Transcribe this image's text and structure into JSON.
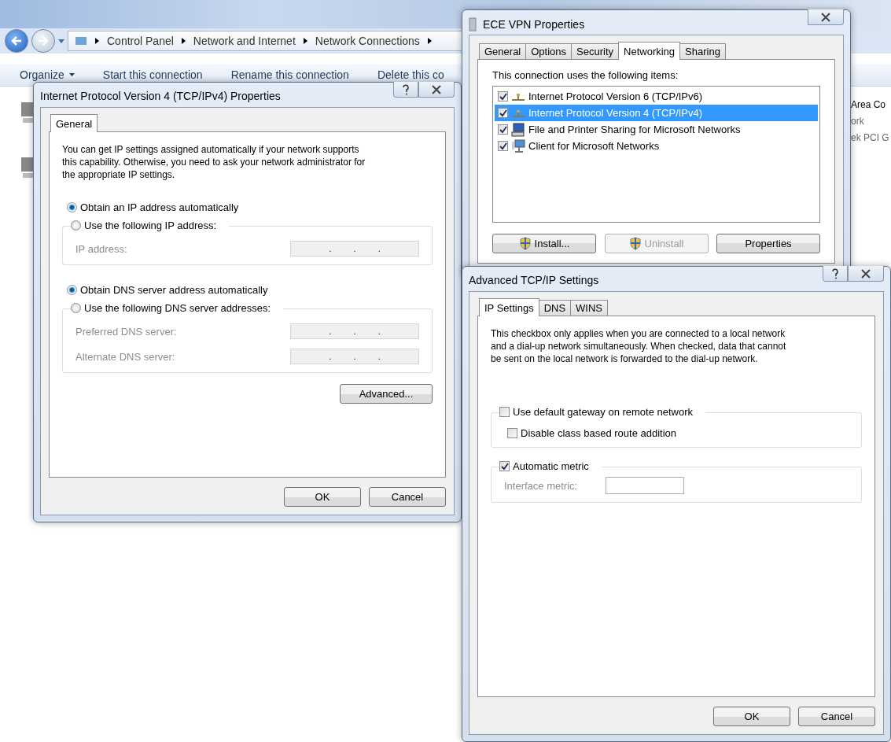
{
  "explorer": {
    "breadcrumb": [
      "Control Panel",
      "Network and Internet",
      "Network Connections"
    ],
    "toolbar": [
      {
        "label": "Organize",
        "menu": true
      },
      {
        "label": "Start this connection",
        "menu": false
      },
      {
        "label": "Rename this connection",
        "menu": false
      },
      {
        "label": "Delete this co",
        "menu": false
      }
    ],
    "partial_items": [
      "Area Co",
      "ork",
      "ek PCI G"
    ]
  },
  "ipv4_dialog": {
    "title": "Internet Protocol Version 4 (TCP/IPv4) Properties",
    "help_button": true,
    "tabs": [
      {
        "label": "General",
        "selected": true
      }
    ],
    "intro_lines": [
      "You can get IP settings assigned automatically if your network supports",
      "this capability. Otherwise, you need to ask your network administrator for",
      "the appropriate IP settings."
    ],
    "ip_group": {
      "options": [
        {
          "label": "Obtain an IP address automatically",
          "selected": true
        },
        {
          "label": "Use the following IP address:",
          "selected": false
        }
      ],
      "fields": [
        {
          "label": "IP address:",
          "disabled": true,
          "separators": [
            ".",
            ".",
            "."
          ]
        }
      ]
    },
    "dns_group": {
      "options": [
        {
          "label": "Obtain DNS server address automatically",
          "selected": true
        },
        {
          "label": "Use the following DNS server addresses:",
          "selected": false
        }
      ],
      "fields": [
        {
          "label": "Preferred DNS server:",
          "disabled": true,
          "separators": [
            ".",
            ".",
            "."
          ]
        },
        {
          "label": "Alternate DNS server:",
          "disabled": true,
          "separators": [
            ".",
            ".",
            "."
          ]
        }
      ]
    },
    "advanced_button": "Advanced...",
    "buttons": [
      "OK",
      "Cancel"
    ]
  },
  "vpn_dialog": {
    "title": "ECE VPN Properties",
    "help_button": false,
    "tabs": [
      {
        "label": "General",
        "selected": false
      },
      {
        "label": "Options",
        "selected": false
      },
      {
        "label": "Security",
        "selected": false
      },
      {
        "label": "Networking",
        "selected": true
      },
      {
        "label": "Sharing",
        "selected": false
      }
    ],
    "list_label": "This connection uses the following items:",
    "items": [
      {
        "label": "Internet Protocol Version 6 (TCP/IPv6)",
        "checked": true,
        "selected": false,
        "kind": "protocol"
      },
      {
        "label": "Internet Protocol Version 4 (TCP/IPv4)",
        "checked": true,
        "selected": true,
        "kind": "protocol"
      },
      {
        "label": "File and Printer Sharing for Microsoft Networks",
        "checked": true,
        "selected": false,
        "kind": "service"
      },
      {
        "label": "Client for Microsoft Networks",
        "checked": true,
        "selected": false,
        "kind": "client"
      }
    ],
    "buttons": [
      {
        "label": "Install...",
        "shield": true,
        "disabled": false
      },
      {
        "label": "Uninstall",
        "shield": true,
        "disabled": true
      },
      {
        "label": "Properties",
        "shield": false,
        "disabled": false
      }
    ]
  },
  "advanced_dialog": {
    "title": "Advanced TCP/IP Settings",
    "help_button": true,
    "tabs": [
      {
        "label": "IP Settings",
        "selected": true
      },
      {
        "label": "DNS",
        "selected": false
      },
      {
        "label": "WINS",
        "selected": false
      }
    ],
    "description_lines": [
      "This checkbox only applies when you are connected to a local network",
      "and a dial-up network simultaneously.  When checked, data that cannot",
      "be sent on the local network is forwarded to the dial-up network."
    ],
    "gateway_group": {
      "legend": {
        "label": "Use default gateway on remote network",
        "checked": false
      },
      "options": [
        {
          "label": "Disable class based route addition",
          "checked": false
        }
      ]
    },
    "metric_group": {
      "legend": {
        "label": "Automatic metric",
        "checked": true
      },
      "field": {
        "label": "Interface metric:",
        "disabled": true
      }
    },
    "buttons": [
      "OK",
      "Cancel"
    ]
  }
}
